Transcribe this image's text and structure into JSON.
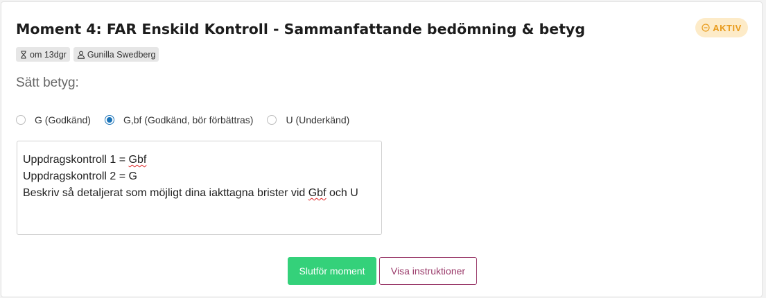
{
  "moment": {
    "title": "Moment 4: FAR Enskild Kontroll - Sammanfattande bedömning & betyg",
    "status_badge": "AKTIV",
    "status_icon": "minus-circle-icon",
    "deadline_chip": "om 13dgr",
    "assignee_chip": "Gunilla Swedberg"
  },
  "grading": {
    "label": "Sätt betyg:",
    "options": [
      {
        "label": "G (Godkänd)",
        "selected": false
      },
      {
        "label": "G,bf (Godkänd, bör förbättras)",
        "selected": true
      },
      {
        "label": "U (Underkänd)",
        "selected": false
      }
    ],
    "comment": {
      "line1_prefix": "Uppdragskontroll 1 = ",
      "line1_word": "Gbf",
      "line2": "Uppdragskontroll 2 = G",
      "line3_prefix": "Beskriv så detaljerat som möjligt dina iakttagna brister vid ",
      "line3_word": "Gbf",
      "line3_suffix": " och U"
    }
  },
  "actions": {
    "complete_label": "Slutför moment",
    "instructions_label": "Visa instruktioner"
  },
  "colors": {
    "accent_green": "#34d17a",
    "accent_plum": "#9a3a6a",
    "badge_bg": "#fdebc8",
    "badge_fg": "#e89a1a",
    "radio_blue": "#1a73b8"
  }
}
